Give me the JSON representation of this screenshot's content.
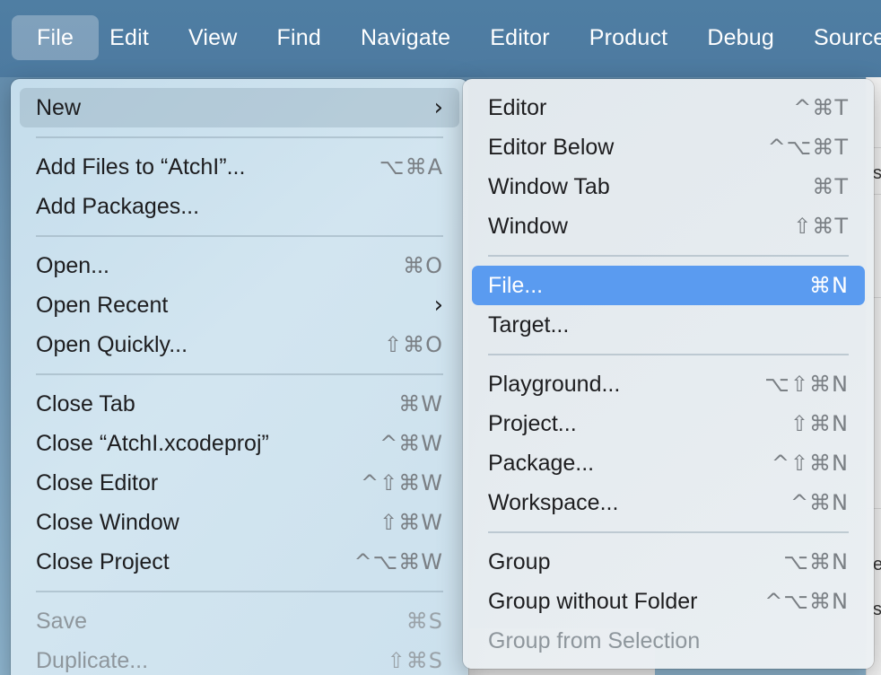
{
  "menubar": {
    "items": [
      "File",
      "Edit",
      "View",
      "Find",
      "Navigate",
      "Editor",
      "Product",
      "Debug",
      "Source"
    ]
  },
  "file_menu": {
    "items": [
      {
        "label": "New",
        "shortcut": "",
        "submenu": true,
        "state": "hover"
      },
      {
        "label": "Add Files to “AtchI”...",
        "shortcut": "⌥⌘A"
      },
      {
        "label": "Add Packages...",
        "shortcut": ""
      },
      {
        "label": "Open...",
        "shortcut": "⌘O"
      },
      {
        "label": "Open Recent",
        "shortcut": "",
        "submenu": true
      },
      {
        "label": "Open Quickly...",
        "shortcut": "⇧⌘O"
      },
      {
        "label": "Close Tab",
        "shortcut": "⌘W"
      },
      {
        "label": "Close “AtchI.xcodeproj”",
        "shortcut": "^⌘W"
      },
      {
        "label": "Close Editor",
        "shortcut": "^⇧⌘W"
      },
      {
        "label": "Close Window",
        "shortcut": "⇧⌘W"
      },
      {
        "label": "Close Project",
        "shortcut": "^⌥⌘W"
      },
      {
        "label": "Save",
        "shortcut": "⌘S",
        "disabled": true
      },
      {
        "label": "Duplicate...",
        "shortcut": "⇧⌘S",
        "disabled": true
      }
    ]
  },
  "new_submenu": {
    "items": [
      {
        "label": "Editor",
        "shortcut": "^⌘T"
      },
      {
        "label": "Editor Below",
        "shortcut": "^⌥⌘T"
      },
      {
        "label": "Window Tab",
        "shortcut": "⌘T"
      },
      {
        "label": "Window",
        "shortcut": "⇧⌘T"
      },
      {
        "label": "File...",
        "shortcut": "⌘N",
        "state": "selected"
      },
      {
        "label": "Target...",
        "shortcut": ""
      },
      {
        "label": "Playground...",
        "shortcut": "⌥⇧⌘N"
      },
      {
        "label": "Project...",
        "shortcut": "⇧⌘N"
      },
      {
        "label": "Package...",
        "shortcut": "^⇧⌘N"
      },
      {
        "label": "Workspace...",
        "shortcut": "^⌘N"
      },
      {
        "label": "Group",
        "shortcut": "⌥⌘N"
      },
      {
        "label": "Group without Folder",
        "shortcut": "^⌥⌘N"
      },
      {
        "label": "Group from Selection",
        "shortcut": "",
        "disabled": true
      }
    ]
  },
  "submenu_chevron": "›",
  "behind_window": {
    "fragments": [
      "s",
      "e",
      "s"
    ]
  },
  "colors": {
    "selection": "#5a9bf0",
    "menubar": "#4f7ea3"
  }
}
